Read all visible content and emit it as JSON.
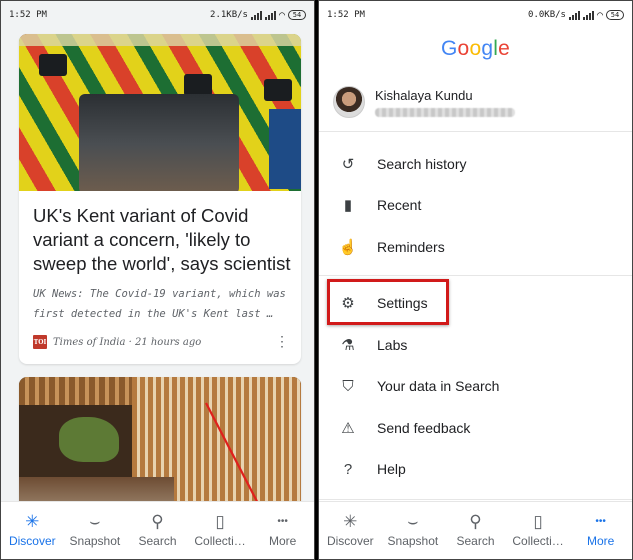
{
  "left": {
    "status": {
      "time": "1:52 PM",
      "speed": "2.1KB/s",
      "battery": "54"
    },
    "card1": {
      "title": "UK's Kent variant of Covid variant a concern, 'likely to sweep the world', says scientist",
      "snippet": "UK News: The Covid-19 variant, which was first detected in the UK's Kent last …",
      "source_logo": "TOI",
      "source": "Times of India · 21 hours ago",
      "more": "⋮"
    },
    "nav": [
      {
        "label": "Discover",
        "icon": "asterisk-icon"
      },
      {
        "label": "Snapshot",
        "icon": "snapshot-icon"
      },
      {
        "label": "Search",
        "icon": "search-icon"
      },
      {
        "label": "Collecti…",
        "icon": "collections-icon"
      },
      {
        "label": "More",
        "icon": "more-icon"
      }
    ],
    "active_nav": "Discover"
  },
  "right": {
    "status": {
      "time": "1:52 PM",
      "speed": "0.0KB/s",
      "battery": "54"
    },
    "google_logo": "Google",
    "account": {
      "name": "Kishalaya Kundu"
    },
    "menu": [
      {
        "label": "Search history",
        "icon": "history-icon"
      },
      {
        "label": "Recent",
        "icon": "recent-icon"
      },
      {
        "label": "Reminders",
        "icon": "reminders-icon"
      },
      {
        "label": "Settings",
        "icon": "gear-icon"
      },
      {
        "label": "Labs",
        "icon": "flask-icon"
      },
      {
        "label": "Your data in Search",
        "icon": "shield-icon"
      },
      {
        "label": "Send feedback",
        "icon": "feedback-icon"
      },
      {
        "label": "Help",
        "icon": "help-icon"
      }
    ],
    "nav": [
      {
        "label": "Discover",
        "icon": "asterisk-icon"
      },
      {
        "label": "Snapshot",
        "icon": "snapshot-icon"
      },
      {
        "label": "Search",
        "icon": "search-icon"
      },
      {
        "label": "Collecti…",
        "icon": "collections-icon"
      },
      {
        "label": "More",
        "icon": "more-icon"
      }
    ],
    "active_nav": "More"
  },
  "colors": {
    "accent": "#1a73e8",
    "highlight": "#d11a1a",
    "arrow": "#e0201c"
  }
}
